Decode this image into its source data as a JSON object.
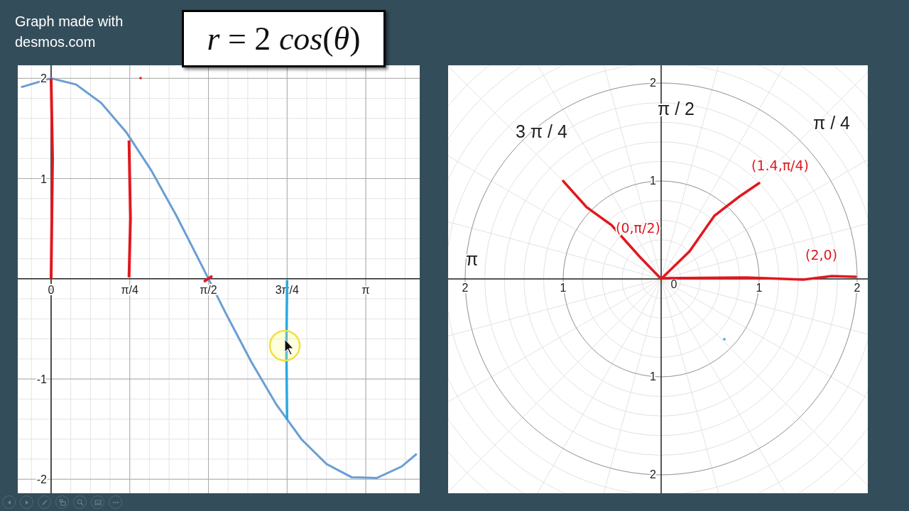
{
  "caption": "Graph made with desmos.com",
  "formula": "*r* = 2 *cos*(*θ*)",
  "cartesian_graph": {
    "chart_data": {
      "type": "line",
      "x": [
        -0.3,
        0,
        0.25,
        0.5,
        0.75,
        1.0,
        1.25,
        1.5,
        1.75,
        2.0,
        2.25,
        2.5,
        2.75,
        3.0,
        3.25,
        3.5,
        3.65
      ],
      "series": [
        {
          "color": "#6a9ed4",
          "values": [
            1.911,
            2,
            1.938,
            1.755,
            1.463,
            1.081,
            0.631,
            0.141,
            -0.356,
            -0.832,
            -1.256,
            -1.602,
            -1.849,
            -1.98,
            -1.988,
            -1.873,
            -1.747
          ]
        }
      ],
      "grid": true,
      "xlim": [
        -0.333,
        3.68
      ],
      "ylim": [
        -2.14,
        2.13
      ],
      "xticks": [
        {
          "value": 0,
          "label": "0"
        },
        {
          "value": 0.7854,
          "label": "π/4"
        },
        {
          "value": 1.5708,
          "label": "π/2"
        },
        {
          "value": 2.3562,
          "label": "3π/4"
        },
        {
          "value": 3.1416,
          "label": "π"
        }
      ],
      "yticks": [
        {
          "value": 2,
          "label": "2"
        },
        {
          "value": 1,
          "label": "1"
        },
        {
          "value": -1,
          "label": "-1"
        },
        {
          "value": -2,
          "label": "-2"
        }
      ]
    }
  },
  "polar_graph": {
    "angle_labels": [
      "π / 4",
      "π / 2",
      "3 π / 4",
      "π"
    ],
    "radius_labels": [
      "2",
      "1",
      "0",
      "1",
      "2",
      "2",
      "1",
      "1",
      "2"
    ],
    "annotations": [
      "(1.4,π/4)",
      "(0,π/2)",
      "(2,0)"
    ]
  }
}
